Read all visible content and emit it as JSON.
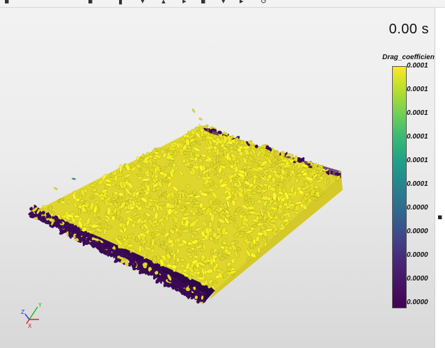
{
  "viewport": {
    "time_readout": "0.00 s",
    "colorbar": {
      "title": "Drag_coefficient",
      "labels": [
        "0.0001",
        "0.0001",
        "0.0001",
        "0.0001",
        "0.0001",
        "0.0001",
        "0.0000",
        "0.0000",
        "0.0000",
        "0.0000",
        "0.0000"
      ],
      "colors": [
        "#fde725",
        "#b5de2b",
        "#6ece58",
        "#35b779",
        "#1f9e89",
        "#26828e",
        "#31688e",
        "#3e4989",
        "#482878",
        "#440154"
      ]
    },
    "axes": {
      "x": "X",
      "y": "Y",
      "z": "Z"
    },
    "axes_colors": {
      "x": "#e02020",
      "y": "#22bb22",
      "z": "#2040e0"
    },
    "particle_colors": {
      "high": "#e5dc2b",
      "low": "#3f0a5c",
      "mid": "#2a9d75"
    }
  }
}
